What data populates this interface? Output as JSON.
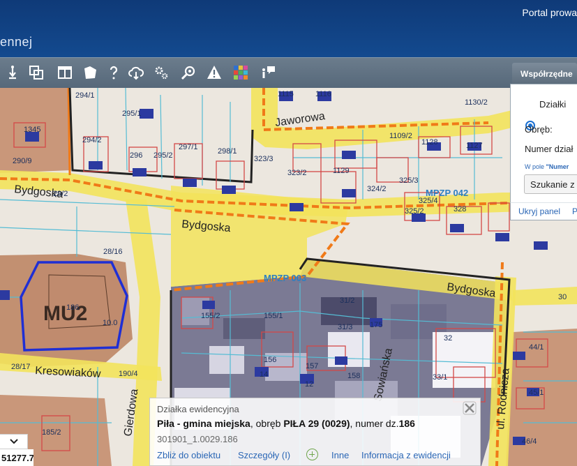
{
  "header": {
    "portal_title": "Portal prowa",
    "app_title": "ennej"
  },
  "toolbar": {
    "tools": [
      "pan-icon",
      "layers-icon",
      "print-layout-icon",
      "draw-polygon-icon",
      "help-icon",
      "upload-icon",
      "settings-icon",
      "search-zoom-icon",
      "warning-icon",
      "basemap-grid-icon",
      "info-chat-icon"
    ]
  },
  "panel": {
    "tab_label": "Współrzędne",
    "radio_label": "Działki",
    "obreb_label": "Obręb:",
    "numer_label": "Numer dział",
    "hint_prefix": "W pole ",
    "hint_bold": "\"Numer",
    "search_value": "Szukanie z",
    "hide_link": "Ukryj panel",
    "other_link": "P"
  },
  "map": {
    "streets": [
      "Jaworowa",
      "Bydgoska",
      "Bydgoska",
      "Bydgoska",
      "Kresowiaków",
      "Gierdowa",
      "Sowiańska",
      "ul. Rodnicza"
    ],
    "zones": [
      "MPZP 042",
      "MPZP 003"
    ],
    "zone_code": "MU2",
    "parcels": [
      "294/1",
      "295/1",
      "294/2",
      "296",
      "295/2",
      "297/1",
      "298/1",
      "1345",
      "290/9",
      "1115",
      "1116",
      "1130/2",
      "1109/2",
      "1128",
      "1127",
      "323/3",
      "323/2",
      "1129",
      "324/2",
      "325/3",
      "325/4",
      "328",
      "325/2",
      "29/2",
      "28/16",
      "186",
      "155/2",
      "155/1",
      "31/2",
      "31/3",
      "175",
      "156",
      "157",
      "158",
      "32",
      "33/1",
      "44/1",
      "45/1",
      "46/4",
      "28/17",
      "190/4",
      "185/2",
      "30",
      "14",
      "12",
      "10.0"
    ]
  },
  "popup": {
    "type": "Działka ewidencyjna",
    "gmina": "Piła - gmina miejska",
    "obreb_text": ", obręb ",
    "obreb_value": "PIŁA 29 (0029)",
    "numer_text": ", numer dz.",
    "numer_value": "186",
    "identifier": "301901_1.0029.186",
    "links": {
      "zoom": "Zbliż do obiektu",
      "details": "Szczegóły (I)",
      "other": "Inne",
      "info": "Informacja z ewidencji"
    }
  },
  "status": {
    "coordinate": "51277.7"
  }
}
